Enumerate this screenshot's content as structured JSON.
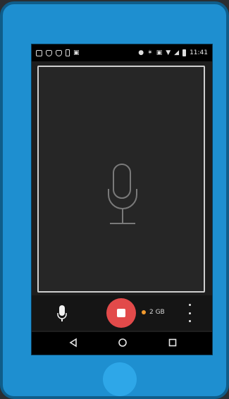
{
  "status_bar": {
    "left_icons": [
      "image-icon",
      "shield-icon",
      "shield-icon",
      "phone-icon",
      "briefcase-icon"
    ],
    "right_icons": [
      "location-icon",
      "bluetooth-icon",
      "vibrate-icon",
      "wifi-icon",
      "signal-icon",
      "battery-icon"
    ],
    "time": "11:41"
  },
  "preview": {
    "icon": "microphone-icon"
  },
  "controls": {
    "mic_icon": "microphone-icon",
    "record_icon": "stop-icon",
    "storage_text": "2 GB",
    "storage_dot_color": "#f29a2e",
    "record_color": "#e24a4a",
    "more_icon": "more-vertical-icon"
  },
  "navigation": {
    "back_icon": "back-icon",
    "home_icon": "home-icon",
    "recent_icon": "recent-apps-icon"
  },
  "device": {
    "frame_color": "#1e8fd0",
    "home_button_color": "#2ea7e8"
  }
}
